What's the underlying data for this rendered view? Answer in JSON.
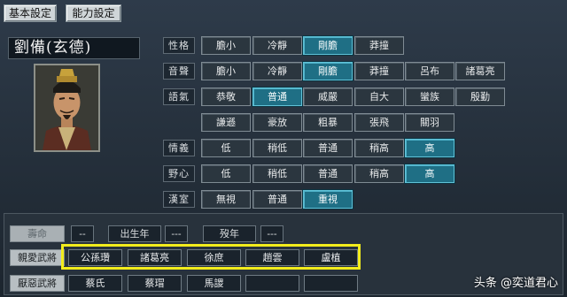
{
  "tabs": {
    "basic": "基本設定",
    "ability": "能力設定"
  },
  "character": {
    "name": "劉備(玄德)"
  },
  "rows": [
    {
      "label": "性格",
      "options": [
        "膽小",
        "冷靜",
        "剛膽",
        "莽撞"
      ],
      "selected": 2
    },
    {
      "label": "音聲",
      "options": [
        "膽小",
        "冷靜",
        "剛膽",
        "莽撞",
        "呂布",
        "諸葛亮"
      ],
      "selected": 2
    },
    {
      "label": "語氣",
      "options": [
        "恭敬",
        "普通",
        "威嚴",
        "自大",
        "蠻族",
        "殷勤",
        "謙遜",
        "豪放",
        "粗暴",
        "張飛",
        "關羽"
      ],
      "selected": 1
    },
    {
      "label": "情義",
      "options": [
        "低",
        "稍低",
        "普通",
        "稍高",
        "高"
      ],
      "selected": 4
    },
    {
      "label": "野心",
      "options": [
        "低",
        "稍低",
        "普通",
        "稍高",
        "高"
      ],
      "selected": 4
    },
    {
      "label": "漢室",
      "options": [
        "無視",
        "普通",
        "重視"
      ],
      "selected": 2
    }
  ],
  "bottom": {
    "lifespan_label": "壽命",
    "lifespan_value": "--",
    "birth_label": "出生年",
    "birth_value": "---",
    "death_label": "歿年",
    "death_value": "---",
    "friends_label": "親愛武將",
    "friends": [
      "公孫瓚",
      "諸葛亮",
      "徐庶",
      "趙雲",
      "盧植"
    ],
    "enemies_label": "厭惡武將",
    "enemies": [
      "蔡氏",
      "蔡瑁",
      "馬謖"
    ]
  },
  "watermark": "头条 @奕道君心",
  "colors": {
    "selected": "#1f6f85",
    "highlight": "#f2ec1c"
  }
}
